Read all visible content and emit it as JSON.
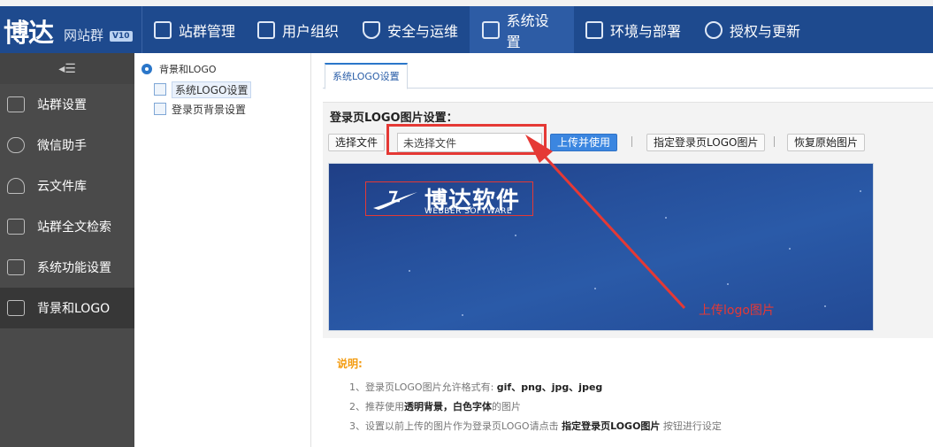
{
  "app": {
    "logo_big": "博达",
    "logo_small": "网站群",
    "version": "V10"
  },
  "nav": [
    {
      "label": "站群管理",
      "icon": "site-manage-icon"
    },
    {
      "label": "用户组织",
      "icon": "user-org-icon"
    },
    {
      "label": "安全与运维",
      "icon": "shield-icon"
    },
    {
      "label": "系统设置",
      "icon": "system-settings-icon",
      "active": true
    },
    {
      "label": "环境与部署",
      "icon": "deploy-icon"
    },
    {
      "label": "授权与更新",
      "icon": "license-icon"
    }
  ],
  "sidebar": {
    "toggle": "◂☰",
    "items": [
      {
        "label": "站群设置"
      },
      {
        "label": "微信助手"
      },
      {
        "label": "云文件库"
      },
      {
        "label": "站群全文检索"
      },
      {
        "label": "系统功能设置"
      },
      {
        "label": "背景和LOGO",
        "active": true
      }
    ]
  },
  "tree": {
    "root": "背景和LOGO",
    "nodes": [
      {
        "label": "系统LOGO设置",
        "selected": true
      },
      {
        "label": "登录页背景设置"
      }
    ]
  },
  "main": {
    "tab": "系统LOGO设置",
    "panel_title": "登录页LOGO图片设置：",
    "choose_file": "选择文件",
    "file_value": "未选择文件",
    "upload": "上传并使用",
    "assign": "指定登录页LOGO图片",
    "restore": "恢复原始图片",
    "preview": {
      "brand_cn": "博达软件",
      "brand_en": "WEBBER SOFTWARE"
    },
    "annotation": "上传logo图片"
  },
  "notes": {
    "title": "说明:",
    "items": [
      {
        "pre": "1、登录页LOGO图片允许格式有: ",
        "bold": "gif、png、jpg、jpeg",
        "post": ""
      },
      {
        "pre": "2、推荐使用",
        "bold": "透明背景，白色字体",
        "post": "的图片"
      },
      {
        "pre": "3、设置以前上传的图片作为登录页LOGO请点击 ",
        "bold": "指定登录页LOGO图片",
        "post": " 按钮进行设定"
      }
    ]
  },
  "colors": {
    "topbar": "#1e4a8e",
    "sidebar": "#4a4a4a",
    "accent": "#3b86e0",
    "highlight": "#e53935",
    "note_title": "#f39c12"
  }
}
